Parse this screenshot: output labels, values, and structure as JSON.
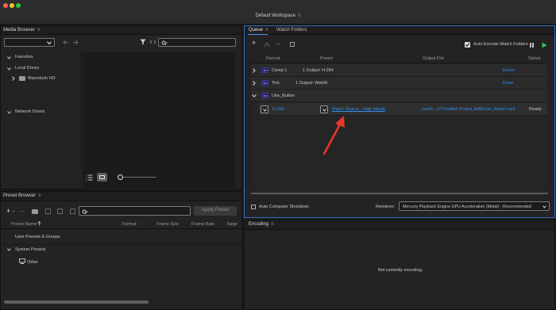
{
  "window": {
    "title": "Default Workspace",
    "traffic_lights": [
      "#ff5f57",
      "#febc2e",
      "#28c840"
    ]
  },
  "media_browser": {
    "title": "Media Browser",
    "tree": {
      "favorites": "Favorites",
      "local_drives": "Local Drives",
      "macintosh_hd": "Macintosh HD",
      "network_drives": "Network Drives"
    }
  },
  "preset_browser": {
    "title": "Preset Browser",
    "apply_preset_label": "Apply Preset",
    "columns": [
      "Preset Name",
      "Format",
      "Frame Size",
      "Frame Rate",
      "Targe"
    ],
    "items": {
      "user_presets": "User Presets & Groups",
      "system_presets": "System Presets",
      "other": "Other"
    }
  },
  "queue": {
    "tabs": [
      "Queue",
      "Watch Folders"
    ],
    "auto_encode_label": "Auto-Encode Watch Folders",
    "auto_encode_checked": true,
    "columns": {
      "format": "Format",
      "preset": "Preset",
      "output_file": "Output File",
      "status": "Status"
    },
    "items": [
      {
        "name": "Comp 1",
        "outputs": "1 Output: H.264",
        "status": "Errors"
      },
      {
        "name": "Tick",
        "outputs": "1 Output: WebM",
        "status": "Done"
      },
      {
        "name": "Like_Button",
        "outputs": "",
        "status": ""
      }
    ],
    "sub_item": {
      "format": "H.264",
      "preset": "Match Source - High bitrate",
      "output_file": "/var/fo...n/T/Untitled Project_AME/Like_Button.mp4",
      "status": "Ready"
    },
    "auto_shutdown_label": "Auto Computer Shutdown",
    "renderer_label": "Renderer:",
    "renderer_value": "Mercury Playback Engine GPU Acceleration (Metal) - Recommended"
  },
  "encoding": {
    "title": "Encoding",
    "status_text": "Not currently encoding."
  },
  "colors": {
    "accent_blue": "#2f8ff2",
    "start_green": "#35c24a",
    "annotation_red": "#e8352a"
  }
}
